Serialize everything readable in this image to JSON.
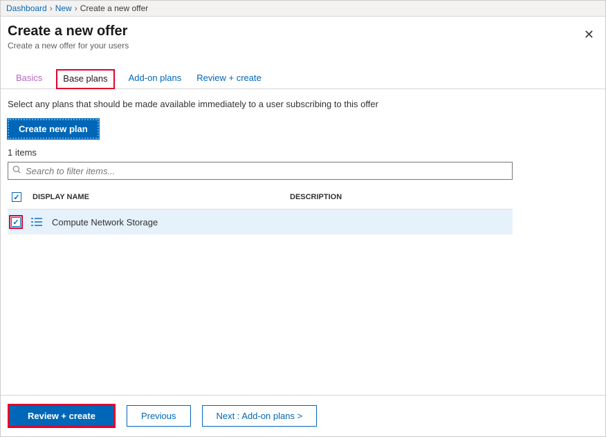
{
  "breadcrumb": {
    "items": [
      {
        "label": "Dashboard",
        "link": true
      },
      {
        "label": "New",
        "link": true
      },
      {
        "label": "Create a new offer",
        "link": false
      }
    ]
  },
  "header": {
    "title": "Create a new offer",
    "subtitle": "Create a new offer for your users"
  },
  "tabs": {
    "basics": "Basics",
    "base_plans": "Base plans",
    "addon_plans": "Add-on plans",
    "review_create": "Review + create"
  },
  "content": {
    "helptext": "Select any plans that should be made available immediately to a user subscribing to this offer",
    "create_plan_label": "Create new plan",
    "item_count": "1 items",
    "search_placeholder": "Search to filter items..."
  },
  "table": {
    "headers": {
      "display_name": "DISPLAY NAME",
      "description": "DESCRIPTION"
    },
    "rows": [
      {
        "checked": true,
        "name": "Compute Network Storage",
        "description": ""
      }
    ]
  },
  "footer": {
    "review_create": "Review + create",
    "previous": "Previous",
    "next": "Next : Add-on plans >"
  }
}
